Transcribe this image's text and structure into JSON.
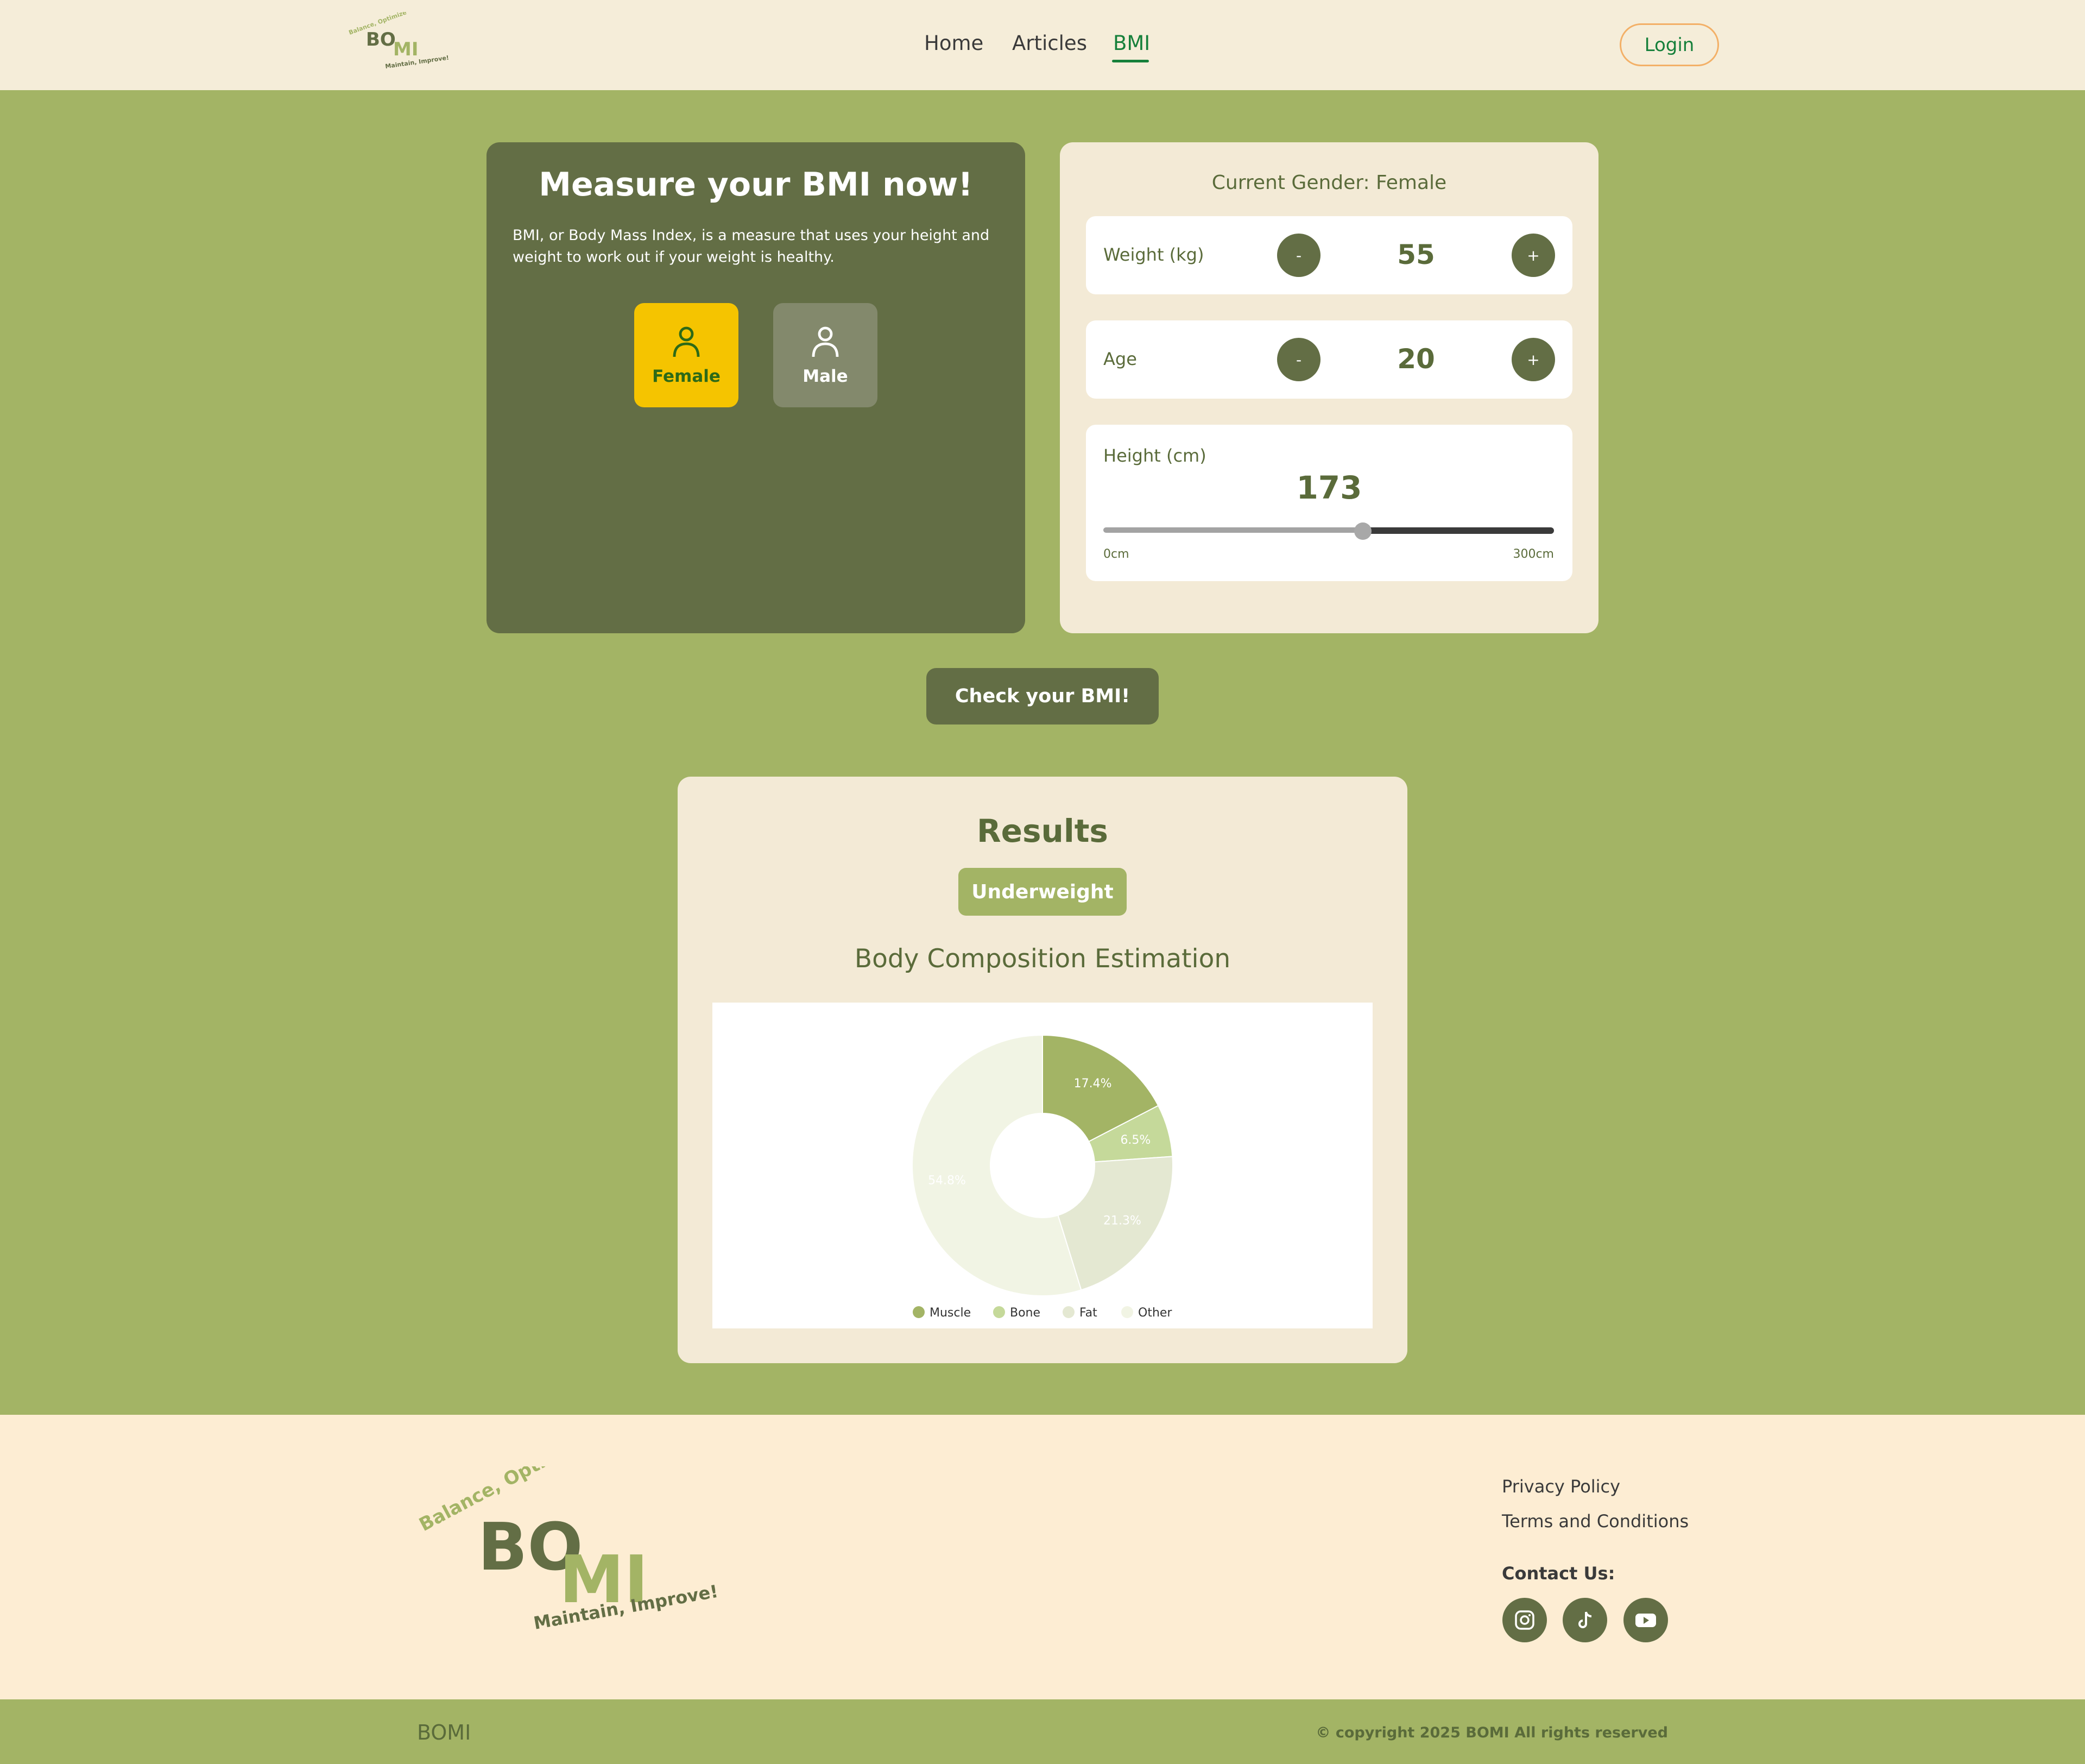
{
  "header": {
    "logo": {
      "top": "Balance, Optimize",
      "main_left": "BO",
      "main_right": "MI",
      "bottom": "Maintain, Improve!"
    },
    "nav": [
      {
        "label": "Home"
      },
      {
        "label": "Articles"
      },
      {
        "label": "BMI"
      }
    ],
    "active_nav": "BMI",
    "login_label": "Login"
  },
  "intro": {
    "title": "Measure your BMI now!",
    "description": "BMI, or Body Mass Index, is a measure that uses your height and weight to work out if your weight is healthy.",
    "genders": [
      {
        "label": "Female",
        "icon": "person-icon",
        "selected": true
      },
      {
        "label": "Male",
        "icon": "person-icon",
        "selected": false
      }
    ]
  },
  "form": {
    "gender_label": "Current Gender: Female",
    "weight": {
      "label": "Weight (kg)",
      "value": "55",
      "minus": "-",
      "plus": "+"
    },
    "age": {
      "label": "Age",
      "value": "20",
      "minus": "-",
      "plus": "+"
    },
    "height": {
      "label": "Height (cm)",
      "value": "173",
      "min_label": "0cm",
      "max_label": "300cm",
      "min": 0,
      "max": 300,
      "current": 173
    }
  },
  "check_button": "Check your BMI!",
  "results": {
    "title": "Results",
    "category": "Underweight",
    "composition_title": "Body Composition Estimation"
  },
  "chart_data": {
    "type": "pie",
    "donut": true,
    "categories": [
      "Muscle",
      "Bone",
      "Fat",
      "Other"
    ],
    "values": [
      17.4,
      6.5,
      21.3,
      54.8
    ],
    "labels": [
      "17.4%",
      "6.5%",
      "21.3%",
      "54.8%"
    ],
    "colors": [
      "#a3b465",
      "#c5d99a",
      "#e4e8d2",
      "#f1f4e4"
    ],
    "legend": "bottom"
  },
  "footer": {
    "logo": {
      "top": "Balance, Optimize",
      "main_left": "BO",
      "main_right": "MI",
      "bottom": "Maintain, Improve!"
    },
    "links": [
      {
        "label": "Privacy Policy"
      },
      {
        "label": "Terms and Conditions"
      }
    ],
    "contact_label": "Contact Us:",
    "socials": [
      {
        "icon": "instagram-icon"
      },
      {
        "icon": "tiktok-icon"
      },
      {
        "icon": "youtube-icon"
      }
    ],
    "brand": "BOMI",
    "copyright": "© copyright 2025 BOMI All rights reserved"
  },
  "colors": {
    "primary": "#a3b465",
    "dark": "#636e45",
    "accent": "#f5c400",
    "active": "#16803b",
    "cream": "#f3ead6"
  }
}
